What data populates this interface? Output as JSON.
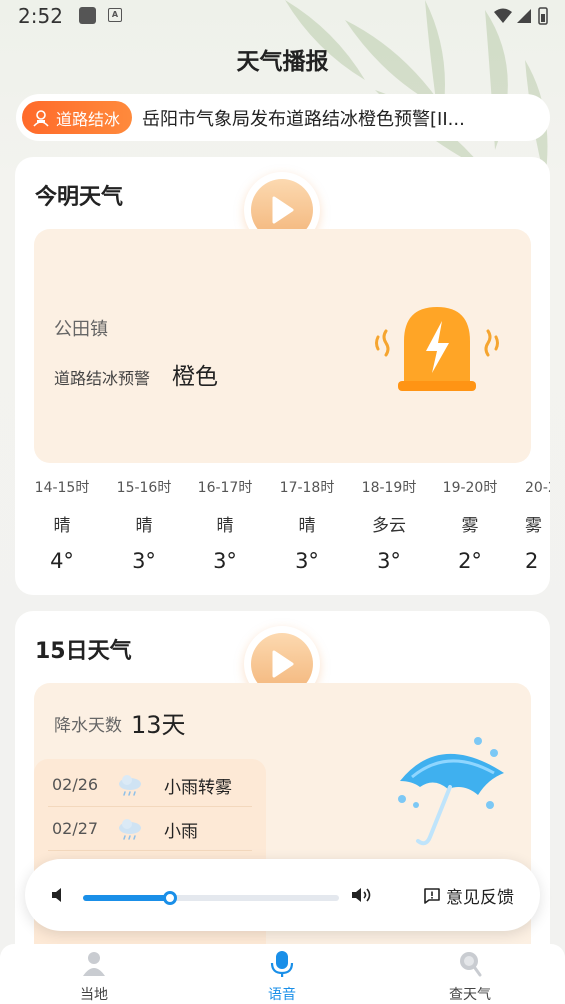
{
  "status_bar": {
    "time": "2:52",
    "notif_glyph": "A"
  },
  "page": {
    "title": "天气播报"
  },
  "alert": {
    "tag": "道路结冰",
    "text": "岳阳市气象局发布道路结冰橙色预警[II..."
  },
  "today_card": {
    "title": "今明天气",
    "town": "公田镇",
    "warning_type": "道路结冰预警",
    "warning_level": "橙色",
    "hourly": [
      {
        "time": "14-15时",
        "weather": "晴",
        "temp": "4°"
      },
      {
        "time": "15-16时",
        "weather": "晴",
        "temp": "3°"
      },
      {
        "time": "16-17时",
        "weather": "晴",
        "temp": "3°"
      },
      {
        "time": "17-18时",
        "weather": "晴",
        "temp": "3°"
      },
      {
        "time": "18-19时",
        "weather": "多云",
        "temp": "3°"
      },
      {
        "time": "19-20时",
        "weather": "雾",
        "temp": "2°"
      },
      {
        "time": "20-2",
        "weather": "雾",
        "temp": "2"
      }
    ]
  },
  "forecast_card": {
    "title": "15日天气",
    "rain_label": "降水天数",
    "rain_days": "13天",
    "days": [
      {
        "date": "02/26",
        "weather": "小雨转雾",
        "icon": "rain-cloud-icon"
      },
      {
        "date": "02/27",
        "weather": "小雨",
        "icon": "rain-cloud-icon"
      }
    ]
  },
  "player": {
    "progress": 0.34,
    "feedback_label": "意见反馈"
  },
  "nav": [
    {
      "label": "当地",
      "icon": "location-person-icon",
      "active": false
    },
    {
      "label": "语音",
      "icon": "microphone-icon",
      "active": true
    },
    {
      "label": "查天气",
      "icon": "search-weather-icon",
      "active": false
    }
  ],
  "colors": {
    "accent": "#1a8fe8",
    "alert_tag": "#ff6a2a",
    "warm_panel": "#fcf0e3",
    "bell": "#ffa526"
  }
}
